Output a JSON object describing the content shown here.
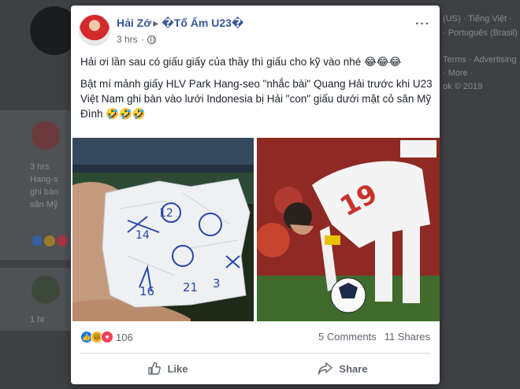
{
  "background": {
    "left_post_time": "3 hrs",
    "left_post_lines": [
      "Hang-s",
      "ghi bàn",
      "sân Mỹ"
    ],
    "left_post2_time": "1 hr",
    "right_links": [
      "(US) · Tiếng Việt ·",
      "· Português (Brasil)",
      "Terms · Advertising",
      "· More ·",
      "ok © 2019"
    ]
  },
  "post": {
    "author": "Hải Zớ",
    "page_name": "�Tổ Ấm U23�",
    "time": "3 hrs",
    "more_label": "···",
    "text_lines": [
      "Hải ơi lần sau có giấu giấy của thầy thì giấu cho kỹ vào nhé 😂😂😂",
      "Bật mí mảnh giấy HLV Park Hang-seo \"nhắc bài\" Quang Hải trước khi U23 Việt Nam ghi bàn vào lưới Indonesia bị Hải \"con\" giấu dưới mặt cỏ sân Mỹ Đình 🤣🤣🤣"
    ],
    "reaction_count": "106",
    "comments": "5 Comments",
    "shares": "11 Shares",
    "like_label": "Like",
    "share_label": "Share",
    "paper_marks": [
      "12",
      "14",
      "16",
      "21",
      "3"
    ],
    "jersey_number": "19"
  },
  "colors": {
    "link_blue": "#365899",
    "like_blue": "#1877f2",
    "love_red": "#f33e58",
    "haha_yellow": "#f7b928"
  }
}
